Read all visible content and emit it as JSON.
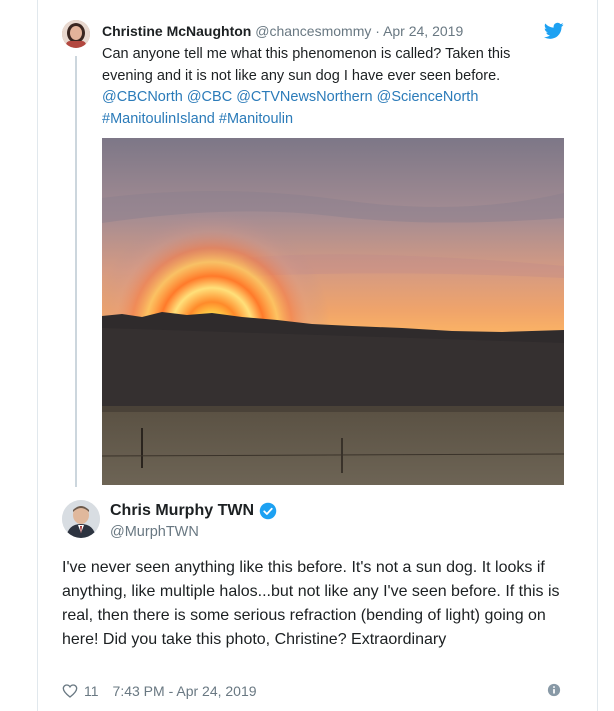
{
  "parent_tweet": {
    "name": "Christine McNaughton",
    "handle": "@chancesmommy",
    "separator": "·",
    "date": "Apr 24, 2019",
    "text_line1": "Can anyone tell me what this phenomenon is called? Taken this",
    "text_line2": "evening and it is not like any sun dog I have ever seen before.",
    "mentions": [
      "@CBCNorth",
      "@CBC",
      "@CTVNewsNorthern",
      "@ScienceNorth"
    ],
    "hashtags": [
      "#ManitoulinIsland",
      "#Manitoulin"
    ]
  },
  "main_tweet": {
    "name": "Chris Murphy TWN",
    "handle": "@MurphTWN",
    "text": "I've never seen anything like this before. It's not a sun dog. It looks if anything, like multiple halos...but not like any I've seen before. If this is real, then there is some serious refraction (bending of light) going on here! Did you take this photo, Christine? Extraordinary",
    "like_count": "11",
    "timestamp": "7:43 PM - Apr 24, 2019"
  },
  "icons": {
    "brand": "twitter-bird-icon",
    "verified": "verified-badge-icon",
    "like": "heart-icon",
    "info": "info-icon"
  },
  "colors": {
    "link": "#2b7bb9",
    "twitter_blue": "#1da1f2",
    "muted": "#697882",
    "text": "#1c2022"
  }
}
